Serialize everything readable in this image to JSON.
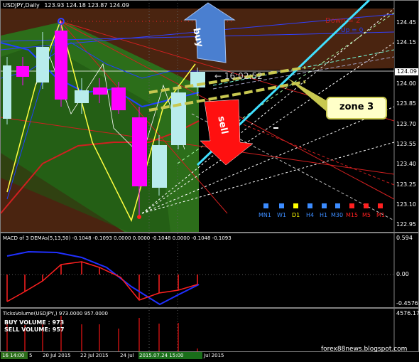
{
  "header": {
    "symbol": "USDJPY,Daily",
    "ohlc": "123.93 124.18 123.87 124.09",
    "down_label": "Down = 2",
    "up_label": "Up = 0"
  },
  "price_axis": {
    "labels": [
      "124.45",
      "124.15",
      "124.00",
      "123.85",
      "123.70",
      "123.55",
      "123.40",
      "123.25",
      "123.10",
      "122.95"
    ],
    "current": "124.09"
  },
  "annotations": {
    "buy": "buy",
    "sell": "sell",
    "zone": "zone 3",
    "timer": "← 16:02:52"
  },
  "timeframes": [
    {
      "label": "MN1",
      "color": "#3c8cff"
    },
    {
      "label": "W1",
      "color": "#3c8cff"
    },
    {
      "label": "D1",
      "color": "#ffff00"
    },
    {
      "label": "H4",
      "color": "#3c8cff"
    },
    {
      "label": "H1",
      "color": "#3c8cff"
    },
    {
      "label": "M30",
      "color": "#3c8cff"
    },
    {
      "label": "M15",
      "color": "#ff2020"
    },
    {
      "label": "M5",
      "color": "#ff2020"
    },
    {
      "label": "M1",
      "color": "#ff2020"
    }
  ],
  "macd": {
    "title": "MACD of 3 DEMAs(5,13,50) -0.1048 -0.1093 0.0000 0.0000 -0.1048 0.0000 -0.1048 -0.1093",
    "axis": [
      "0.594",
      "0.00",
      "-0.4576"
    ]
  },
  "volume": {
    "title": "TicksVolume(USDJPY,) 973.0000 957.0000",
    "buy": "BUY VOLUME : 973",
    "sell": "SELL VOLUME: 957",
    "axis_max": "4576.175"
  },
  "time_axis": {
    "cursor_label": "16 14:00",
    "labels": [
      "5",
      "20 Jul 2015",
      "22 Jul 2015",
      "24 Jul",
      "Jul 2015"
    ],
    "highlight": "2015.07.24 15:00"
  },
  "watermark": "forex88news.blogspot.com",
  "colors": {
    "bull": "#b8ecec",
    "bear": "#ff00ff",
    "accent_cyan": "#40e0ff",
    "zone_fill": "#2c6e1a",
    "brown": "#4a2410"
  }
}
